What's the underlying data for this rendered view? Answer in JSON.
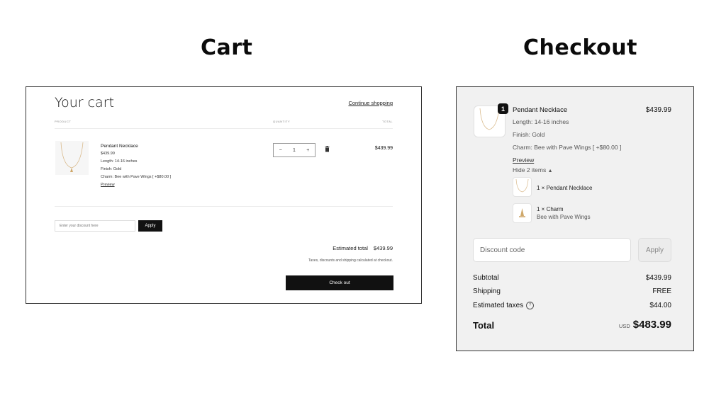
{
  "headings": {
    "cart": "Cart",
    "checkout": "Checkout"
  },
  "cart": {
    "title": "Your cart",
    "continue_link": "Continue shopping",
    "columns": {
      "product": "PRODUCT",
      "quantity": "QUANTITY",
      "total": "TOTAL"
    },
    "item": {
      "name": "Pendant Necklace",
      "price": "$439.99",
      "length": "Length: 14-16 inches",
      "finish": "Finish: Gold",
      "charm": "Charm: Bee with Pave Wings [ +$80.00 ]",
      "preview": "Preview",
      "quantity": "1",
      "minus": "−",
      "plus": "+",
      "line_total": "$439.99"
    },
    "discount_placeholder": "Enter your discount here",
    "apply_label": "Apply",
    "estimated_total_label": "Estimated total",
    "estimated_total_value": "$439.99",
    "tax_note": "Taxes, discounts and shipping calculated at checkout.",
    "checkout_label": "Check out"
  },
  "checkout": {
    "badge": "1",
    "item_name": "Pendant Necklace",
    "item_price": "$439.99",
    "length": "Length: 14-16 inches",
    "finish": "Finish: Gold",
    "charm": "Charm: Bee with Pave Wings [ +$80.00 ]",
    "preview": "Preview",
    "hide_items": "Hide 2 items",
    "sub_items": [
      {
        "label": "1 × Pendant Necklace",
        "desc": ""
      },
      {
        "label": "1 × Charm",
        "desc": "Bee with Pave Wings"
      }
    ],
    "discount_placeholder": "Discount code",
    "apply_label": "Apply",
    "subtotal_label": "Subtotal",
    "subtotal_value": "$439.99",
    "shipping_label": "Shipping",
    "shipping_value": "FREE",
    "taxes_label": "Estimated taxes",
    "taxes_value": "$44.00",
    "total_label": "Total",
    "currency": "USD",
    "total_value": "$483.99"
  },
  "colors": {
    "checkout_bg": "#f1f1f1",
    "button": "#111111"
  }
}
